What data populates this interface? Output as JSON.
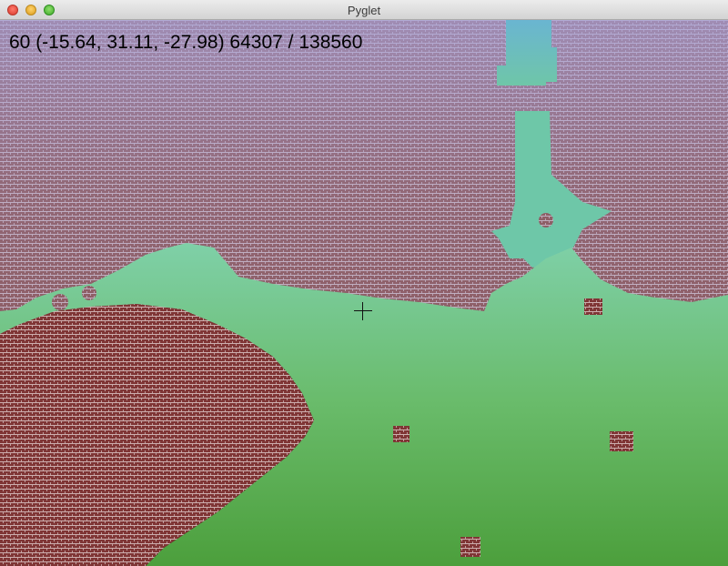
{
  "window": {
    "title": "Pyglet",
    "buttons": [
      "close",
      "minimize",
      "zoom"
    ]
  },
  "hud": {
    "text": "60 (-15.64, 31.11, -27.98) 64307 / 138560"
  },
  "scene": {
    "colors": {
      "brick": "#8e5a5e",
      "brick_sky": "#9b8fb8",
      "grass_top": "#86d49a",
      "grass_bottom": "#4fa64a",
      "water": "#6ab5d1",
      "brick_dark": "#7a3a3a"
    }
  }
}
